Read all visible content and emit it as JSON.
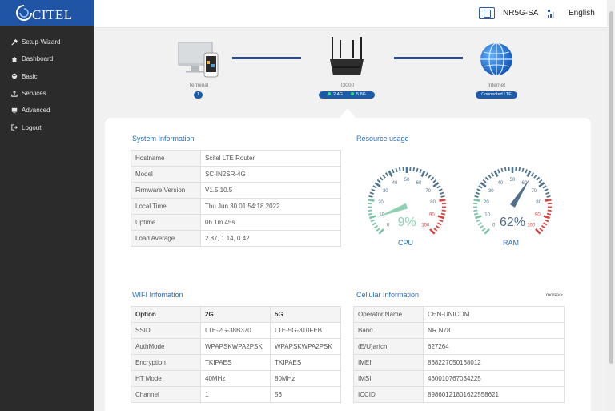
{
  "brand": {
    "logo_text": "CITEL"
  },
  "sidebar": {
    "items": [
      {
        "label": "Setup-Wizard",
        "icon": "wrench-icon"
      },
      {
        "label": "Dashboard",
        "icon": "home-icon"
      },
      {
        "label": "Basic",
        "icon": "globe-icon"
      },
      {
        "label": "Services",
        "icon": "cloud-upload-icon"
      },
      {
        "label": "Advanced",
        "icon": "monitor-icon"
      },
      {
        "label": "Logout",
        "icon": "logout-icon"
      }
    ]
  },
  "header": {
    "network_mode": "NR5G-SA",
    "language": "English"
  },
  "topology": {
    "terminal": {
      "label": "Terminal",
      "count": "1"
    },
    "router": {
      "label": "I3000",
      "band_2g": "2.4G",
      "band_5g": "5.8G"
    },
    "internet": {
      "label": "Internet",
      "status": "Connected LTE"
    }
  },
  "system_info": {
    "title": "System Information",
    "rows": [
      {
        "key": "Hostname",
        "value": "Scitel LTE Router"
      },
      {
        "key": "Model",
        "value": "SC-IN2SR-4G"
      },
      {
        "key": "Firmware Version",
        "value": "V1.5.10.5"
      },
      {
        "key": "Local Time",
        "value": "Thu Jun 30 01:54:18 2022"
      },
      {
        "key": "Uptime",
        "value": "0h 1m 45s"
      },
      {
        "key": "Load Average",
        "value": "2.87, 1.14, 0.42"
      }
    ]
  },
  "resource": {
    "title": "Resource usage",
    "ticks": [
      "0",
      "10",
      "20",
      "30",
      "40",
      "50",
      "60",
      "70",
      "80",
      "90",
      "100"
    ],
    "cpu": {
      "label": "CPU",
      "value": 9,
      "display": "9%"
    },
    "ram": {
      "label": "RAM",
      "value": 62,
      "display": "62%"
    },
    "colors": {
      "low": "#7cc4a6",
      "mid": "#4f7590",
      "high": "#d64541",
      "needle_cpu": "#8fcfb3",
      "needle_ram": "#516f8b"
    }
  },
  "wifi": {
    "title": "WIFI Infomation",
    "headers": [
      "Option",
      "2G",
      "5G"
    ],
    "rows": [
      [
        "SSID",
        "LTE-2G-38B370",
        "LTE-5G-310FEB"
      ],
      [
        "AuthMode",
        "WPAPSKWPA2PSK",
        "WPAPSKWPA2PSK"
      ],
      [
        "Encryption",
        "TKIPAES",
        "TKIPAES"
      ],
      [
        "HT Mode",
        "40MHz",
        "80MHz"
      ],
      [
        "Channel",
        "1",
        "56"
      ]
    ]
  },
  "cellular": {
    "title": "Cellular Information",
    "more": "more>>",
    "rows": [
      {
        "key": "Operator Name",
        "value": "CHN-UNICOM"
      },
      {
        "key": "Band",
        "value": "NR N78"
      },
      {
        "key": "(E/U)arfcn",
        "value": "627264"
      },
      {
        "key": "IMEI",
        "value": "868227050168012"
      },
      {
        "key": "IMSI",
        "value": "460010767034225"
      },
      {
        "key": "ICCID",
        "value": "89860121801622558621"
      }
    ]
  }
}
